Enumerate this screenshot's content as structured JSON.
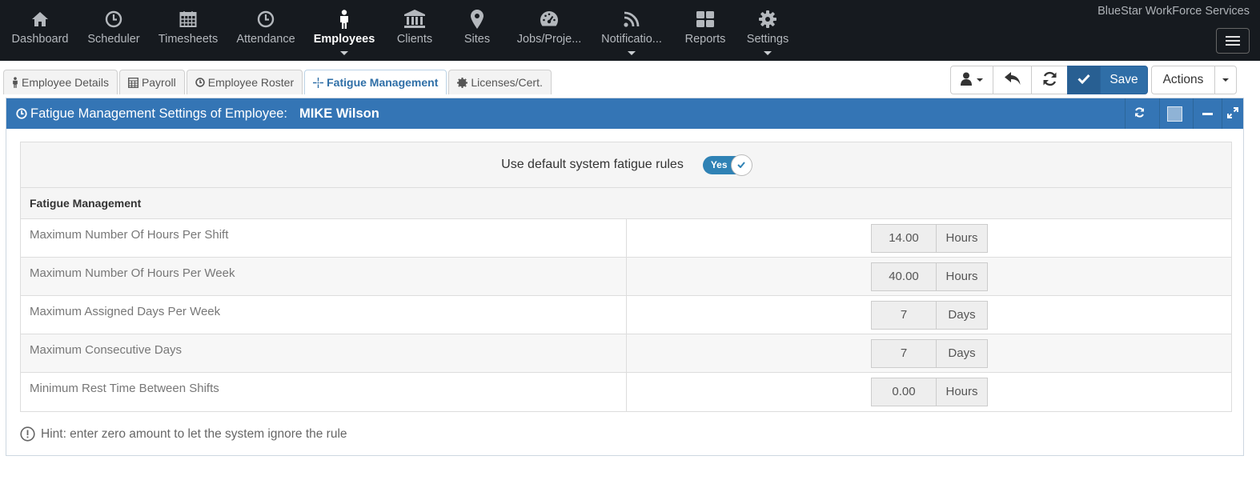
{
  "brand": "BlueStar WorkForce Services",
  "nav": [
    {
      "label": "Dashboard",
      "icon": "home-icon",
      "active": false,
      "caret": false
    },
    {
      "label": "Scheduler",
      "icon": "clock-icon",
      "active": false,
      "caret": false
    },
    {
      "label": "Timesheets",
      "icon": "calendar-icon",
      "active": false,
      "caret": false
    },
    {
      "label": "Attendance",
      "icon": "clock-icon",
      "active": false,
      "caret": false
    },
    {
      "label": "Employees",
      "icon": "person-icon",
      "active": true,
      "caret": true
    },
    {
      "label": "Clients",
      "icon": "bank-icon",
      "active": false,
      "caret": false
    },
    {
      "label": "Sites",
      "icon": "map-marker-icon",
      "active": false,
      "caret": false
    },
    {
      "label": "Jobs/Proje...",
      "icon": "dashboard-gauge-icon",
      "active": false,
      "caret": false
    },
    {
      "label": "Notificatio...",
      "icon": "rss-icon",
      "active": false,
      "caret": true
    },
    {
      "label": "Reports",
      "icon": "grid-icon",
      "active": false,
      "caret": false
    },
    {
      "label": "Settings",
      "icon": "gear-icon",
      "active": false,
      "caret": true
    }
  ],
  "tabs": [
    {
      "label": "Employee Details",
      "icon": "person-icon",
      "active": false
    },
    {
      "label": "Payroll",
      "icon": "calculator-icon",
      "active": false
    },
    {
      "label": "Employee Roster",
      "icon": "clock-icon",
      "active": false
    },
    {
      "label": "Fatigue Management",
      "icon": "crosshair-icon",
      "active": true
    },
    {
      "label": "Licenses/Cert.",
      "icon": "certificate-icon",
      "active": false
    }
  ],
  "toolbar": {
    "save_label": "Save",
    "actions_label": "Actions"
  },
  "portlet": {
    "title": "Fatigue Management Settings of Employee:",
    "employee_name": "MIKE Wilson"
  },
  "default_rules": {
    "label": "Use default system fatigue rules",
    "toggle_label": "Yes",
    "enabled": true
  },
  "section_title": "Fatigue Management",
  "rules": [
    {
      "label": "Maximum Number Of Hours Per Shift",
      "value": "14.00",
      "unit": "Hours"
    },
    {
      "label": "Maximum Number Of Hours Per Week",
      "value": "40.00",
      "unit": "Hours"
    },
    {
      "label": "Maximum Assigned Days Per Week",
      "value": "7",
      "unit": "Days"
    },
    {
      "label": "Maximum Consecutive Days",
      "value": "7",
      "unit": "Days"
    },
    {
      "label": "Minimum Rest Time Between Shifts",
      "value": "0.00",
      "unit": "Hours"
    }
  ],
  "hint": "Hint: enter zero amount to let the system ignore the rule",
  "colors": {
    "nav_bg": "#161a1f",
    "header_blue": "#3475b5",
    "active_tab_text": "#2f6fa7",
    "toggle_on": "#2f82b5"
  }
}
